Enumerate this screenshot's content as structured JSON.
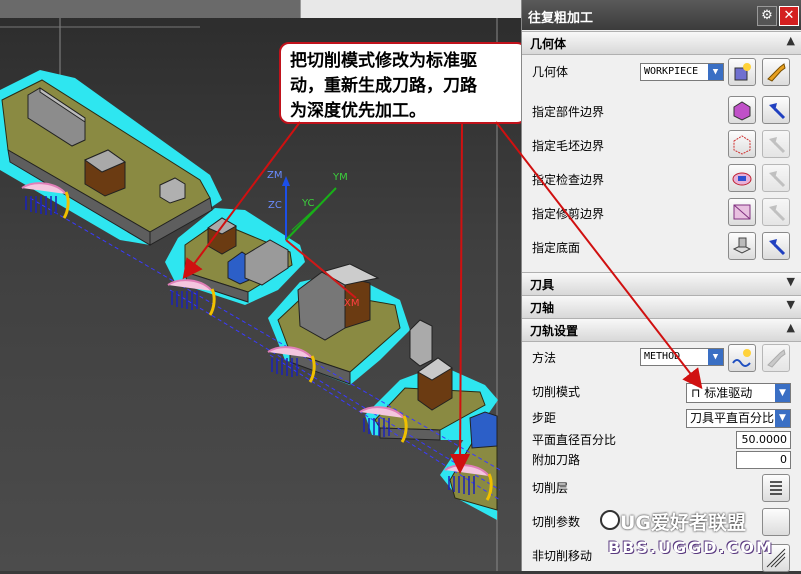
{
  "callout": {
    "lines": [
      "把切削模式修改为标准驱",
      "动，重新生成刀路，刀路",
      "为深度优先加工。"
    ]
  },
  "axes": {
    "zm": "ZM",
    "ym": "YM",
    "zc": "ZC",
    "yc": "YC",
    "xm": "XM"
  },
  "panel": {
    "title": "往复粗加工",
    "sections": {
      "geometry": "几何体",
      "tool": "刀具",
      "axis": "刀轴",
      "path_settings": "刀轨设置"
    },
    "geometry": {
      "label": "几何体",
      "value": "WORKPIECE",
      "rows": [
        "指定部件边界",
        "指定毛坯边界",
        "指定检查边界",
        "指定修剪边界",
        "指定底面"
      ]
    },
    "path": {
      "method_label": "方法",
      "method_value": "METHOD",
      "cut_mode_label": "切削模式",
      "cut_mode_value": "标准驱动",
      "stepover_label": "步距",
      "stepover_value": "刀具平直百分比",
      "flat_pct_label": "平面直径百分比",
      "flat_pct_value": "50.0000",
      "additional_label": "附加刀路",
      "additional_value": "0",
      "cut_levels_label": "切削层",
      "cut_params_label": "切削参数",
      "non_cut_label": "非切削移动"
    }
  },
  "watermark": {
    "line1": "UG爱好者联盟",
    "line2": "BBS.UGGD.COM"
  },
  "colors": {
    "accent": "#c0121b",
    "highlight": "#2ee6f0",
    "part": "#8a8a42"
  }
}
